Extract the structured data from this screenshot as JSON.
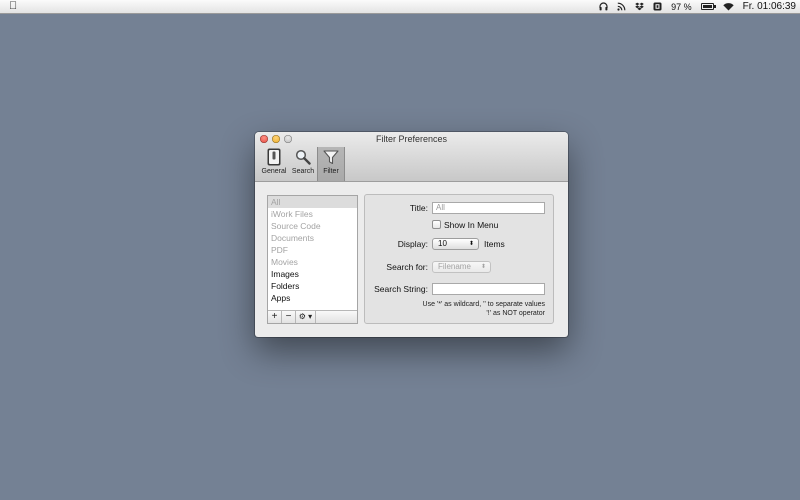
{
  "menubar": {
    "battery_percent": "97 %",
    "battery_level": 0.97,
    "clock": "Fr. 01:06:39",
    "icons": [
      "apple-icon",
      "headphones-icon",
      "rss-icon",
      "dropbox-icon",
      "app-status-icon",
      "battery-icon",
      "wifi-icon"
    ]
  },
  "window": {
    "title": "Filter Preferences",
    "toolbar": {
      "general": "General",
      "search": "Search",
      "filter": "Filter",
      "selected": "Filter"
    },
    "filters": [
      {
        "label": "All",
        "enabled": false,
        "selected": true
      },
      {
        "label": "iWork Files",
        "enabled": false
      },
      {
        "label": "Source Code",
        "enabled": false
      },
      {
        "label": "Documents",
        "enabled": false
      },
      {
        "label": "PDF",
        "enabled": false
      },
      {
        "label": "Movies",
        "enabled": false
      },
      {
        "label": "Images",
        "enabled": true
      },
      {
        "label": "Folders",
        "enabled": true
      },
      {
        "label": "Apps",
        "enabled": true
      }
    ],
    "list_buttons": {
      "add": "+",
      "remove": "−",
      "gear": "⚙ ▾"
    },
    "detail": {
      "title_label": "Title:",
      "title_value": "All",
      "show_in_menu_label": "Show In Menu",
      "show_in_menu_checked": false,
      "display_label": "Display:",
      "display_value": "10",
      "items_label": "Items",
      "search_for_label": "Search for:",
      "search_for_value": "Filename",
      "search_string_label": "Search String:",
      "search_string_value": "",
      "hint_line1": "Use '*' as wildcard, '' to separate values",
      "hint_line2": "'!' as NOT operator"
    }
  },
  "colors": {
    "desktop": "#748194",
    "close": "#e0443a",
    "minimize": "#e8a91f"
  }
}
